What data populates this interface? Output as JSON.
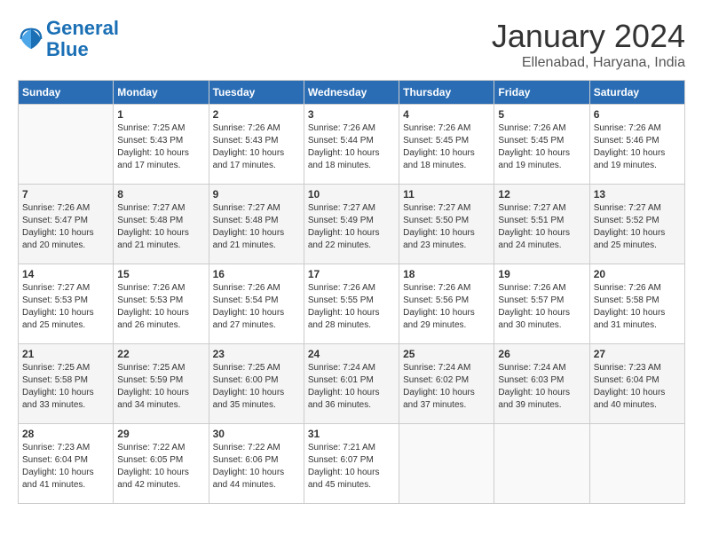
{
  "header": {
    "logo_line1": "General",
    "logo_line2": "Blue",
    "month_title": "January 2024",
    "location": "Ellenabad, Haryana, India"
  },
  "days_of_week": [
    "Sunday",
    "Monday",
    "Tuesday",
    "Wednesday",
    "Thursday",
    "Friday",
    "Saturday"
  ],
  "weeks": [
    [
      {
        "day": "",
        "sunrise": "",
        "sunset": "",
        "daylight": ""
      },
      {
        "day": "1",
        "sunrise": "Sunrise: 7:25 AM",
        "sunset": "Sunset: 5:43 PM",
        "daylight": "Daylight: 10 hours and 17 minutes."
      },
      {
        "day": "2",
        "sunrise": "Sunrise: 7:26 AM",
        "sunset": "Sunset: 5:43 PM",
        "daylight": "Daylight: 10 hours and 17 minutes."
      },
      {
        "day": "3",
        "sunrise": "Sunrise: 7:26 AM",
        "sunset": "Sunset: 5:44 PM",
        "daylight": "Daylight: 10 hours and 18 minutes."
      },
      {
        "day": "4",
        "sunrise": "Sunrise: 7:26 AM",
        "sunset": "Sunset: 5:45 PM",
        "daylight": "Daylight: 10 hours and 18 minutes."
      },
      {
        "day": "5",
        "sunrise": "Sunrise: 7:26 AM",
        "sunset": "Sunset: 5:45 PM",
        "daylight": "Daylight: 10 hours and 19 minutes."
      },
      {
        "day": "6",
        "sunrise": "Sunrise: 7:26 AM",
        "sunset": "Sunset: 5:46 PM",
        "daylight": "Daylight: 10 hours and 19 minutes."
      }
    ],
    [
      {
        "day": "7",
        "sunrise": "Sunrise: 7:26 AM",
        "sunset": "Sunset: 5:47 PM",
        "daylight": "Daylight: 10 hours and 20 minutes."
      },
      {
        "day": "8",
        "sunrise": "Sunrise: 7:27 AM",
        "sunset": "Sunset: 5:48 PM",
        "daylight": "Daylight: 10 hours and 21 minutes."
      },
      {
        "day": "9",
        "sunrise": "Sunrise: 7:27 AM",
        "sunset": "Sunset: 5:48 PM",
        "daylight": "Daylight: 10 hours and 21 minutes."
      },
      {
        "day": "10",
        "sunrise": "Sunrise: 7:27 AM",
        "sunset": "Sunset: 5:49 PM",
        "daylight": "Daylight: 10 hours and 22 minutes."
      },
      {
        "day": "11",
        "sunrise": "Sunrise: 7:27 AM",
        "sunset": "Sunset: 5:50 PM",
        "daylight": "Daylight: 10 hours and 23 minutes."
      },
      {
        "day": "12",
        "sunrise": "Sunrise: 7:27 AM",
        "sunset": "Sunset: 5:51 PM",
        "daylight": "Daylight: 10 hours and 24 minutes."
      },
      {
        "day": "13",
        "sunrise": "Sunrise: 7:27 AM",
        "sunset": "Sunset: 5:52 PM",
        "daylight": "Daylight: 10 hours and 25 minutes."
      }
    ],
    [
      {
        "day": "14",
        "sunrise": "Sunrise: 7:27 AM",
        "sunset": "Sunset: 5:53 PM",
        "daylight": "Daylight: 10 hours and 25 minutes."
      },
      {
        "day": "15",
        "sunrise": "Sunrise: 7:26 AM",
        "sunset": "Sunset: 5:53 PM",
        "daylight": "Daylight: 10 hours and 26 minutes."
      },
      {
        "day": "16",
        "sunrise": "Sunrise: 7:26 AM",
        "sunset": "Sunset: 5:54 PM",
        "daylight": "Daylight: 10 hours and 27 minutes."
      },
      {
        "day": "17",
        "sunrise": "Sunrise: 7:26 AM",
        "sunset": "Sunset: 5:55 PM",
        "daylight": "Daylight: 10 hours and 28 minutes."
      },
      {
        "day": "18",
        "sunrise": "Sunrise: 7:26 AM",
        "sunset": "Sunset: 5:56 PM",
        "daylight": "Daylight: 10 hours and 29 minutes."
      },
      {
        "day": "19",
        "sunrise": "Sunrise: 7:26 AM",
        "sunset": "Sunset: 5:57 PM",
        "daylight": "Daylight: 10 hours and 30 minutes."
      },
      {
        "day": "20",
        "sunrise": "Sunrise: 7:26 AM",
        "sunset": "Sunset: 5:58 PM",
        "daylight": "Daylight: 10 hours and 31 minutes."
      }
    ],
    [
      {
        "day": "21",
        "sunrise": "Sunrise: 7:25 AM",
        "sunset": "Sunset: 5:58 PM",
        "daylight": "Daylight: 10 hours and 33 minutes."
      },
      {
        "day": "22",
        "sunrise": "Sunrise: 7:25 AM",
        "sunset": "Sunset: 5:59 PM",
        "daylight": "Daylight: 10 hours and 34 minutes."
      },
      {
        "day": "23",
        "sunrise": "Sunrise: 7:25 AM",
        "sunset": "Sunset: 6:00 PM",
        "daylight": "Daylight: 10 hours and 35 minutes."
      },
      {
        "day": "24",
        "sunrise": "Sunrise: 7:24 AM",
        "sunset": "Sunset: 6:01 PM",
        "daylight": "Daylight: 10 hours and 36 minutes."
      },
      {
        "day": "25",
        "sunrise": "Sunrise: 7:24 AM",
        "sunset": "Sunset: 6:02 PM",
        "daylight": "Daylight: 10 hours and 37 minutes."
      },
      {
        "day": "26",
        "sunrise": "Sunrise: 7:24 AM",
        "sunset": "Sunset: 6:03 PM",
        "daylight": "Daylight: 10 hours and 39 minutes."
      },
      {
        "day": "27",
        "sunrise": "Sunrise: 7:23 AM",
        "sunset": "Sunset: 6:04 PM",
        "daylight": "Daylight: 10 hours and 40 minutes."
      }
    ],
    [
      {
        "day": "28",
        "sunrise": "Sunrise: 7:23 AM",
        "sunset": "Sunset: 6:04 PM",
        "daylight": "Daylight: 10 hours and 41 minutes."
      },
      {
        "day": "29",
        "sunrise": "Sunrise: 7:22 AM",
        "sunset": "Sunset: 6:05 PM",
        "daylight": "Daylight: 10 hours and 42 minutes."
      },
      {
        "day": "30",
        "sunrise": "Sunrise: 7:22 AM",
        "sunset": "Sunset: 6:06 PM",
        "daylight": "Daylight: 10 hours and 44 minutes."
      },
      {
        "day": "31",
        "sunrise": "Sunrise: 7:21 AM",
        "sunset": "Sunset: 6:07 PM",
        "daylight": "Daylight: 10 hours and 45 minutes."
      },
      {
        "day": "",
        "sunrise": "",
        "sunset": "",
        "daylight": ""
      },
      {
        "day": "",
        "sunrise": "",
        "sunset": "",
        "daylight": ""
      },
      {
        "day": "",
        "sunrise": "",
        "sunset": "",
        "daylight": ""
      }
    ]
  ]
}
